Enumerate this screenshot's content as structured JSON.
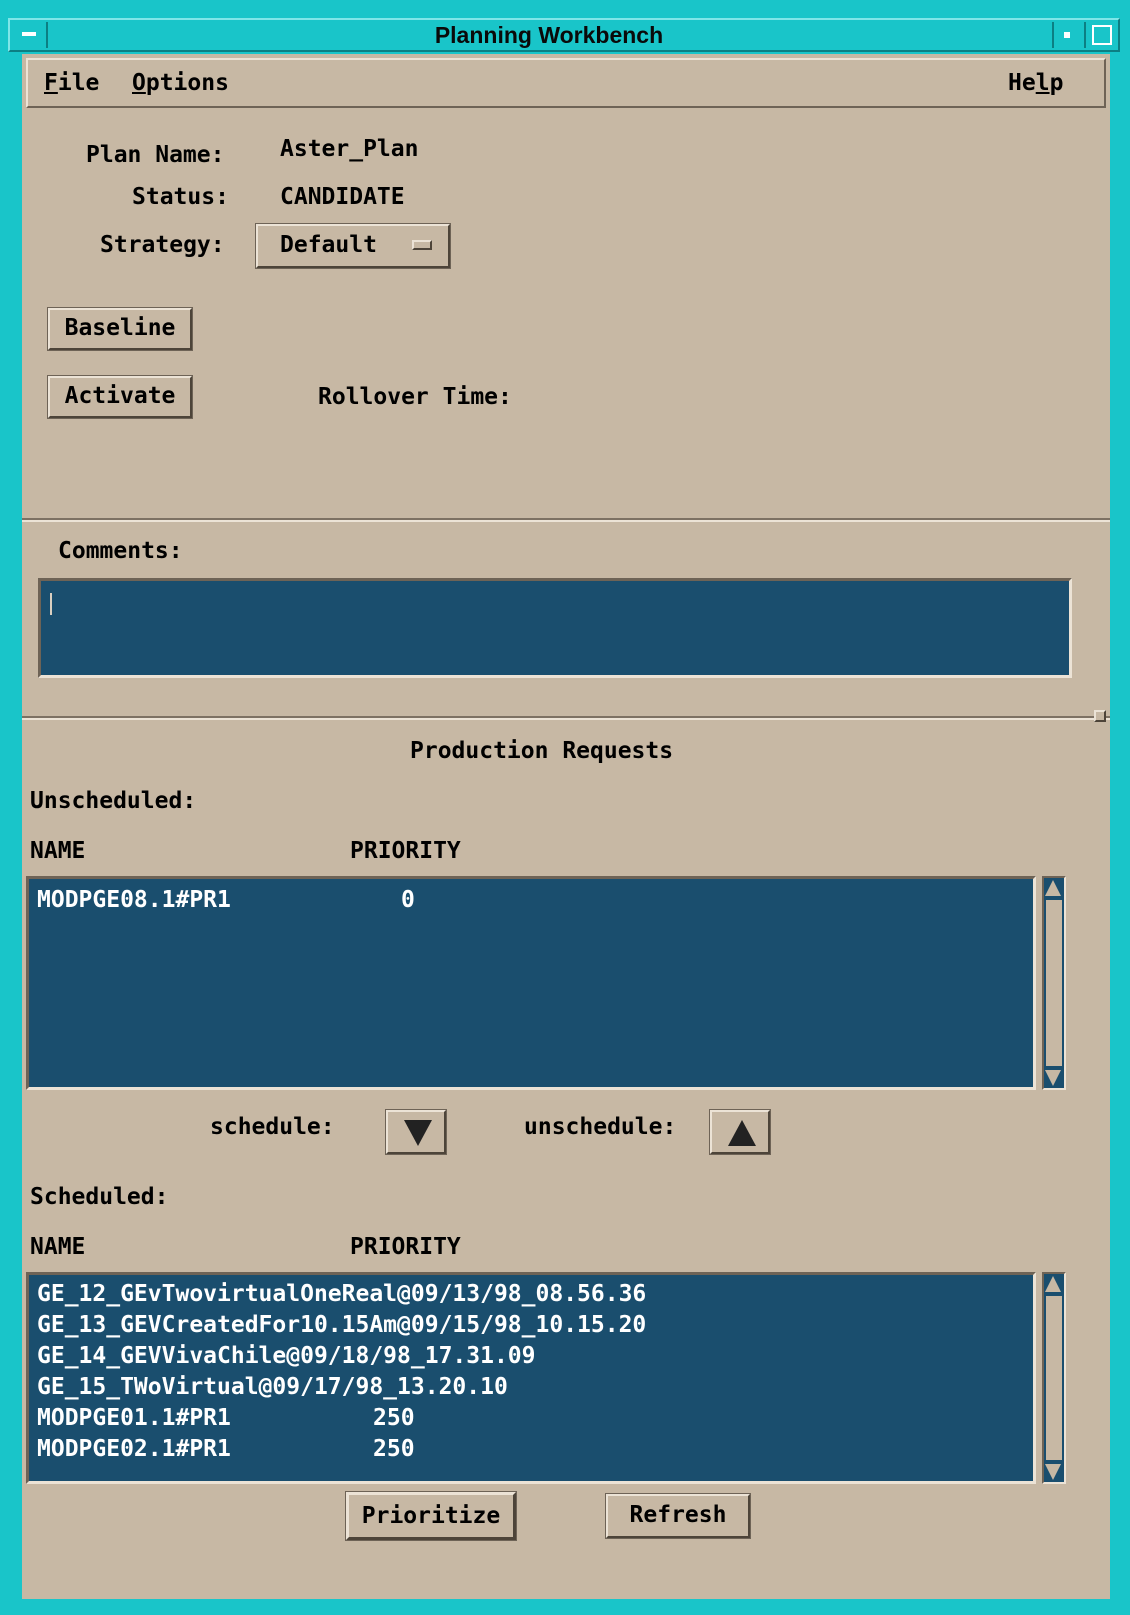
{
  "window": {
    "title": "Planning Workbench"
  },
  "menubar": {
    "file": {
      "mnemonic": "F",
      "rest": "ile"
    },
    "options": {
      "mnemonic": "O",
      "rest": "ptions"
    },
    "help": {
      "pre": "He",
      "mnemonic": "l",
      "rest": "p"
    }
  },
  "plan": {
    "name_label": "Plan Name:",
    "name_value": "Aster_Plan",
    "status_label": "Status:",
    "status_value": "CANDIDATE",
    "strategy_label": "Strategy:",
    "strategy_value": "Default"
  },
  "actions": {
    "baseline_label": "Baseline",
    "activate_label": "Activate",
    "rollover_label": "Rollover Time:"
  },
  "comments": {
    "label": "Comments:"
  },
  "production": {
    "title": "Production Requests",
    "unscheduled_label": "Unscheduled:",
    "name_header": "NAME",
    "priority_header": "PRIORITY",
    "unscheduled_rows": [
      {
        "name": "MODPGE08.1#PR1",
        "priority": "0"
      }
    ],
    "schedule_label": "schedule:",
    "unschedule_label": "unschedule:",
    "scheduled_label": "Scheduled:",
    "scheduled_name_header": "NAME",
    "scheduled_priority_header": "PRIORITY",
    "scheduled_rows": [
      {
        "name": "GE_12_GEvTwovirtualOneReal@09/13/98_08.56.36",
        "priority": ""
      },
      {
        "name": "GE_13_GEVCreatedFor10.15Am@09/15/98_10.15.20",
        "priority": ""
      },
      {
        "name": "GE_14_GEVVivaChile@09/18/98_17.31.09",
        "priority": ""
      },
      {
        "name": "GE_15_TWoVirtual@09/17/98_13.20.10",
        "priority": ""
      },
      {
        "name": "MODPGE01.1#PR1",
        "priority": "250"
      },
      {
        "name": "MODPGE02.1#PR1",
        "priority": "250"
      }
    ]
  },
  "footer": {
    "prioritize_label": "Prioritize",
    "refresh_label": "Refresh"
  }
}
